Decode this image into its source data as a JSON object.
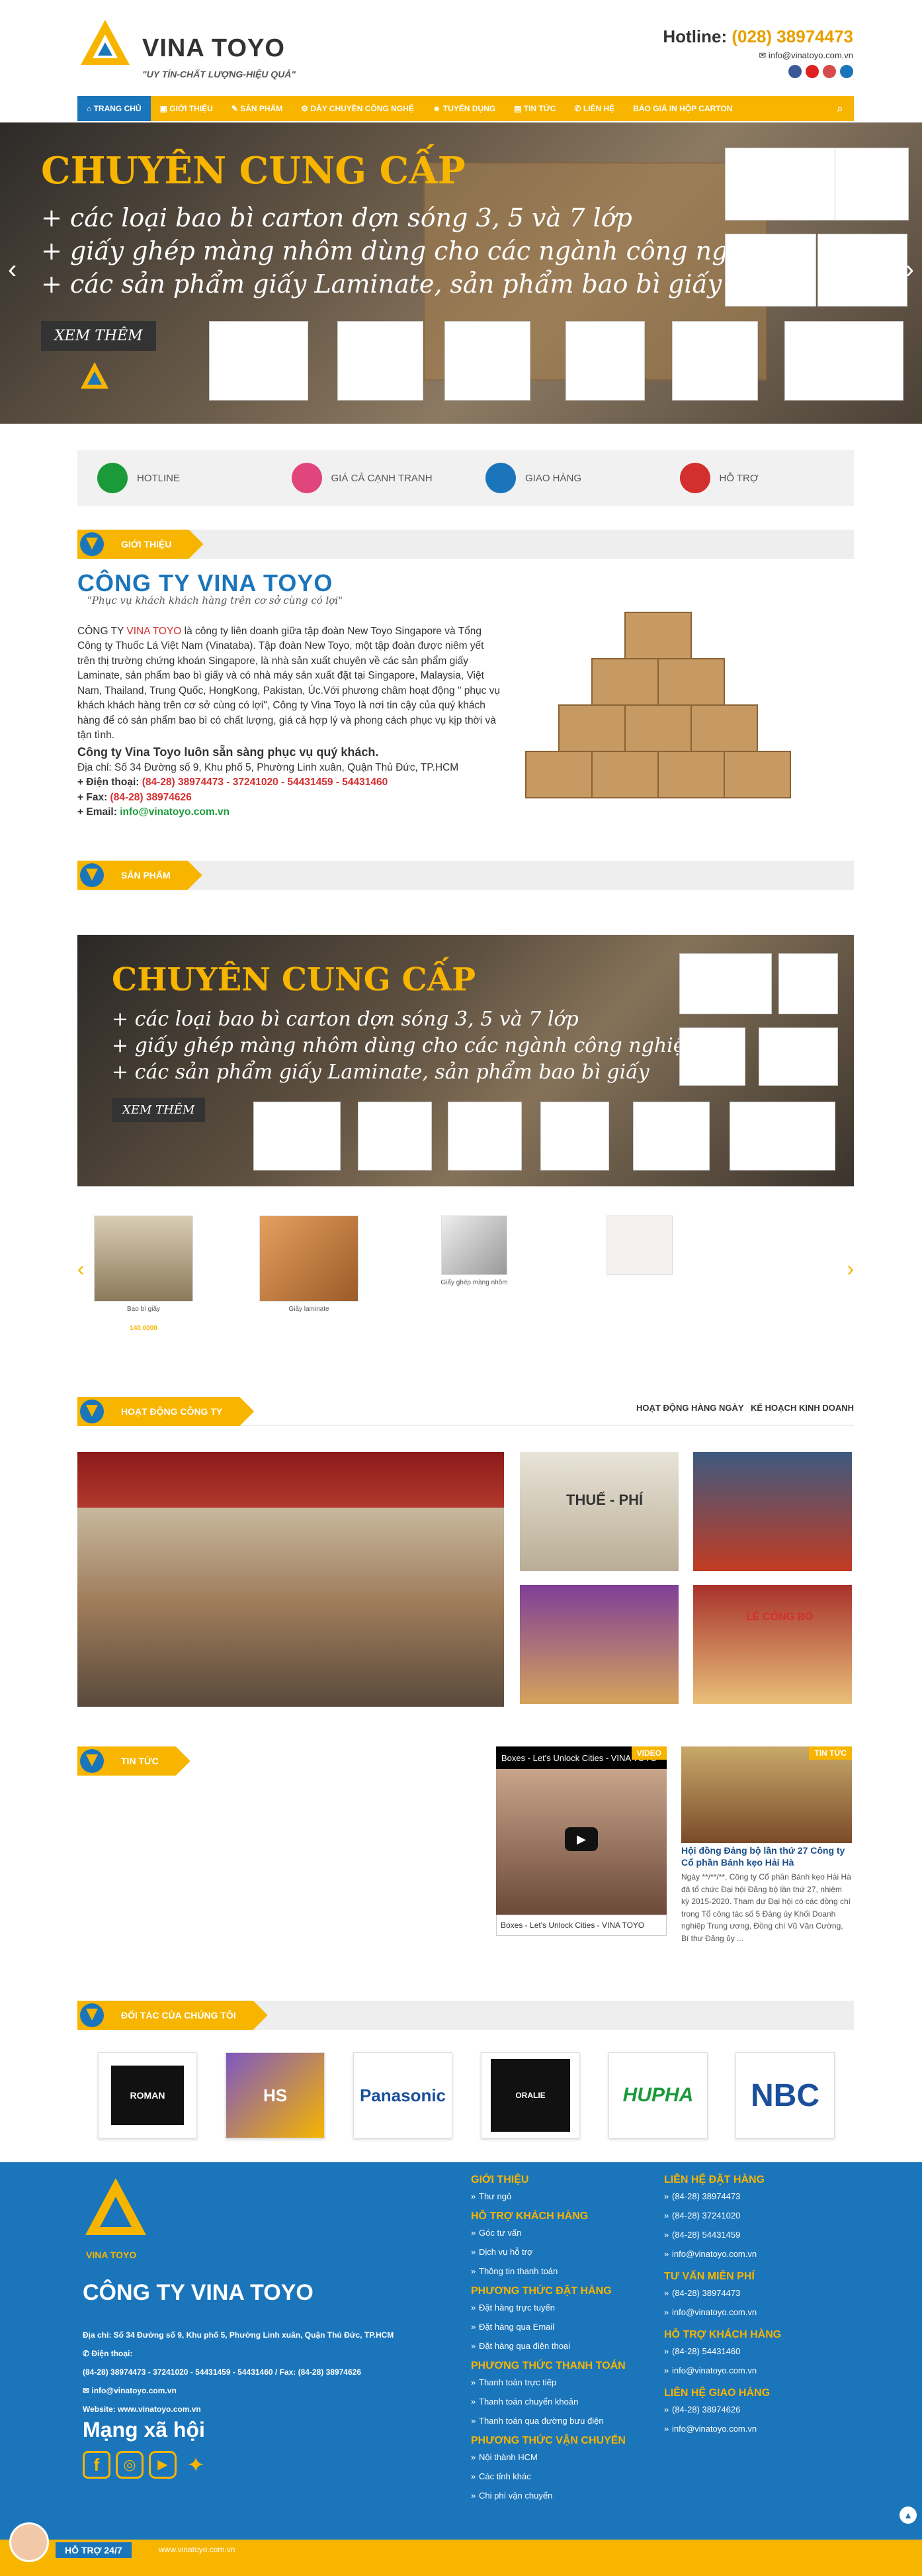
{
  "header": {
    "brand": "VINA TOYO",
    "slogan": "\"UY TÍN-CHẤT LƯỢNG-HIỆU QUẢ\"",
    "hotline_label": "Hotline:",
    "hotline_number": "(028) 38974473",
    "email": "info@vinatoyo.com.vn",
    "social": [
      "facebook-icon",
      "youtube-icon",
      "twitter-icon",
      "zalo-icon"
    ]
  },
  "nav": {
    "items": [
      "TRANG CHỦ",
      "GIỚI THIỆU",
      "SẢN PHẨM",
      "DÂY CHUYỀN CÔNG NGHỆ",
      "TUYỂN DỤNG",
      "TIN TỨC",
      "LIÊN HỆ",
      "BÁO GIÁ IN HỘP CARTON"
    ],
    "active": "TRANG CHỦ"
  },
  "banner": {
    "title": "CHUYÊN CUNG CẤP",
    "lines": [
      "+ các loại bao bì carton dợn sóng 3, 5 và 7 lớp",
      "+ giấy ghép màng nhôm dùng cho các ngành công nghiệp",
      "+ các sản phẩm giấy Laminate, sản phẩm bao bì giấy"
    ],
    "button": "XEM THÊM"
  },
  "features": [
    "HOTLINE",
    "GIÁ CẢ CẠNH TRANH",
    "GIAO HÀNG",
    "HỖ TRỢ"
  ],
  "sections": {
    "intro": "GIỚI THIỆU",
    "products": "SẢN PHẨM",
    "activities": "HOẠT ĐỘNG CÔNG TY",
    "news": "TIN TỨC",
    "partners": "ĐỐI TÁC CỦA CHÚNG TÔI"
  },
  "intro": {
    "title": "CÔNG TY VINA TOYO",
    "subtitle": "\"Phục vụ khách khách hàng trên cơ sở cùng có lợi\"",
    "p1_a": "CÔNG TY ",
    "p1_red": "VINA TOYO",
    "p1_b": " là công ty liên doanh giữa tập đoàn New Toyo Singapore và Tổng Công ty Thuốc Lá Việt Nam (Vinataba). Tập đoàn New Toyo, một tập đoàn được niêm yết trên thị trường chứng khoán Singapore, là nhà sản xuất chuyên về các sản phẩm giấy Laminate, sản phẩm bao bì giấy và có nhà máy sản xuất đặt tại Singapore, Malaysia, Việt Nam, Thailand, Trung Quốc, HongKong, Pakistan, Úc.Với phương châm hoạt động \" phục vụ khách khách hàng trên cơ sở cùng có lợi\", Công ty Vina Toyo là nơi tin cậy của quý khách hàng để có sản phẩm bao bì có chất lượng, giá cả hợp lý và phong cách phục vụ kịp thời và tận tình.",
    "bold_line": "Công ty Vina Toyo luôn sẵn sàng phục vụ quý khách.",
    "address": "Địa chỉ: Số 34 Đường số 9, Khu phố 5, Phường Linh xuân, Quận Thủ Đức, TP.HCM",
    "phone_label": "+ Điện thoại: ",
    "phone": "(84-28) 38974473 - 37241020 - 54431459 - 54431460",
    "fax_label": "+ Fax: ",
    "fax": "(84-28) 38974626",
    "email_label": "+ Email: ",
    "email": "info@vinatoyo.com.vn"
  },
  "products": [
    {
      "name": "Bao bì giấy",
      "price": "140.0000"
    },
    {
      "name": "Giấy laminate",
      "price": ""
    },
    {
      "name": "Giấy ghép màng nhôm",
      "price": ""
    },
    {
      "name": "",
      "price": ""
    }
  ],
  "activity_tabs": [
    "HOẠT ĐỘNG HÀNG NGÀY",
    "KẾ HOẠCH KINH DOANH"
  ],
  "activities": {
    "photo_label": "THUẾ - PHÍ",
    "announce_title": "LỄ CÔNG BỐ"
  },
  "news": {
    "video_title": "Boxes - Let's Unlock Cities - VINA TOYO",
    "video_badge": "VIDEO",
    "news_badge": "TIN TỨC",
    "headline": "Hội đồng Đảng bộ lần thứ 27 Công ty Cổ phần Bánh kẹo Hải Hà",
    "excerpt": "Ngày **/**/**, Công ty Cổ phần Bánh kẹo Hải Hà đã tổ chức Đại hội Đảng bộ lần thứ 27, nhiệm kỳ 2015-2020. Tham dự Đại hội có các đồng chí trong Tổ công tác số 5 Đảng ủy Khối Doanh nghiệp Trung ương, Đồng chí Vũ Văn Cường, Bí thư Đảng ủy ..."
  },
  "partners": [
    "ROMAN",
    "HS",
    "Panasonic",
    "ORALIE",
    "HUPHA",
    "NBC"
  ],
  "footer": {
    "company": "CÔNG TY VINA TOYO",
    "logo_text": "VINA TOYO",
    "address": "Địa chỉ: Số 34 Đường số 9, Khu phố 5, Phường Linh xuân, Quận Thủ Đức, TP.HCM",
    "phone_label": "Điện thoại:",
    "phones": "(84-28) 38974473 - 37241020 - 54431459 - 54431460 / Fax: (84-28) 38974626",
    "email": "info@vinatoyo.com.vn",
    "website": "Website: www.vinatoyo.com.vn",
    "social_title": "Mạng xã hội",
    "col2": [
      {
        "h": "GIỚI THIỆU",
        "items": [
          "Thư ngỏ"
        ]
      },
      {
        "h": "HỖ TRỢ KHÁCH HÀNG",
        "items": [
          "Góc tư vấn",
          "Dịch vụ hỗ trợ",
          "Thông tin thanh toán"
        ]
      },
      {
        "h": "PHƯƠNG THỨC ĐẶT HÀNG",
        "items": [
          "Đặt hàng trực tuyến",
          "Đặt hàng qua Email",
          "Đặt hàng qua điện thoại"
        ]
      },
      {
        "h": "PHƯƠNG THỨC THANH TOÁN",
        "items": [
          "Thanh toán trực tiếp",
          "Thanh toán chuyển khoản",
          "Thanh toán qua đường bưu điện"
        ]
      },
      {
        "h": "PHƯƠNG THỨC VẬN CHUYỂN",
        "items": [
          "Nội thành HCM",
          "Các tỉnh khác",
          "Chi phí vận chuyển"
        ]
      }
    ],
    "col3": [
      {
        "h": "LIÊN HỆ ĐẶT HÀNG",
        "items": [
          "(84-28) 38974473",
          "(84-28) 37241020",
          "(84-28) 54431459",
          "info@vinatoyo.com.vn"
        ]
      },
      {
        "h": "TƯ VẤN MIỄN PHÍ",
        "items": [
          "(84-28) 38974473",
          "info@vinatoyo.com.vn"
        ]
      },
      {
        "h": "HỖ TRỢ KHÁCH HÀNG",
        "items": [
          "(84-28) 54431460",
          "info@vinatoyo.com.vn"
        ]
      },
      {
        "h": "LIÊN HỆ GIAO HÀNG",
        "items": [
          "(84-28) 38974626",
          "info@vinatoyo.com.vn"
        ]
      }
    ]
  },
  "bottom": {
    "support": "HỖ TRỢ 24/7",
    "website": "www.vinatoyo.com.vn"
  },
  "colors": {
    "primary": "#1b75bb",
    "accent": "#f7b500"
  }
}
